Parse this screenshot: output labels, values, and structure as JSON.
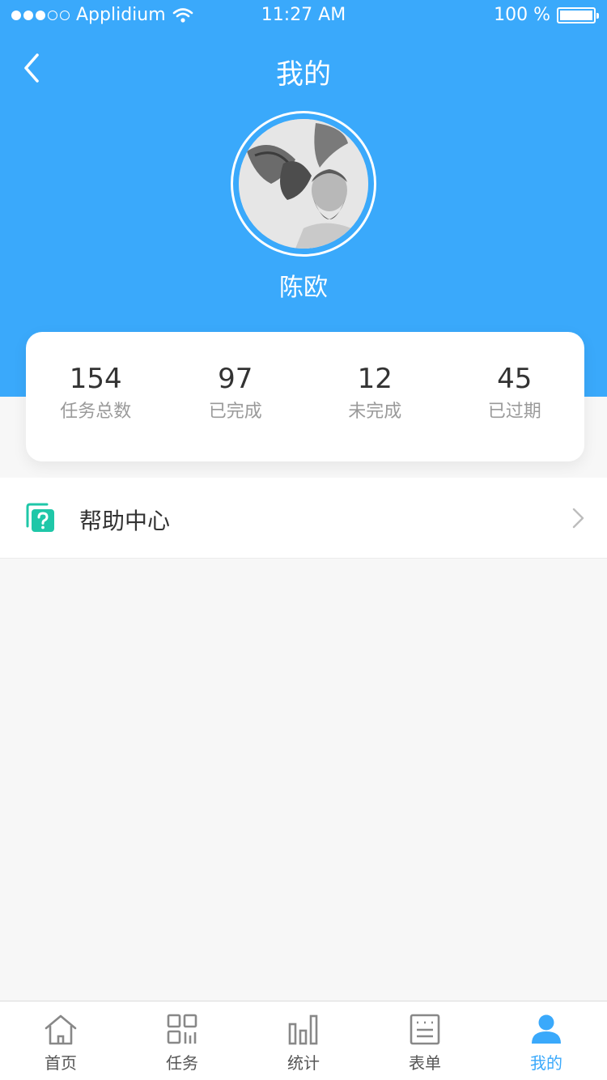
{
  "status_bar": {
    "carrier": "Applidium",
    "time": "11:27 AM",
    "battery": "100 %"
  },
  "header": {
    "title": "我的"
  },
  "profile": {
    "name": "陈欧"
  },
  "stats": [
    {
      "value": "154",
      "label": "任务总数"
    },
    {
      "value": "97",
      "label": "已完成"
    },
    {
      "value": "12",
      "label": "未完成"
    },
    {
      "value": "45",
      "label": "已过期"
    }
  ],
  "menu": {
    "help_label": "帮助中心"
  },
  "tabs": [
    {
      "label": "首页",
      "icon": "home-icon"
    },
    {
      "label": "任务",
      "icon": "grid-icon"
    },
    {
      "label": "统计",
      "icon": "bar-chart-icon"
    },
    {
      "label": "表单",
      "icon": "form-icon"
    },
    {
      "label": "我的",
      "icon": "user-icon",
      "active": true
    }
  ],
  "colors": {
    "primary": "#3aa9fb",
    "help_icon": "#1fc7a8"
  }
}
